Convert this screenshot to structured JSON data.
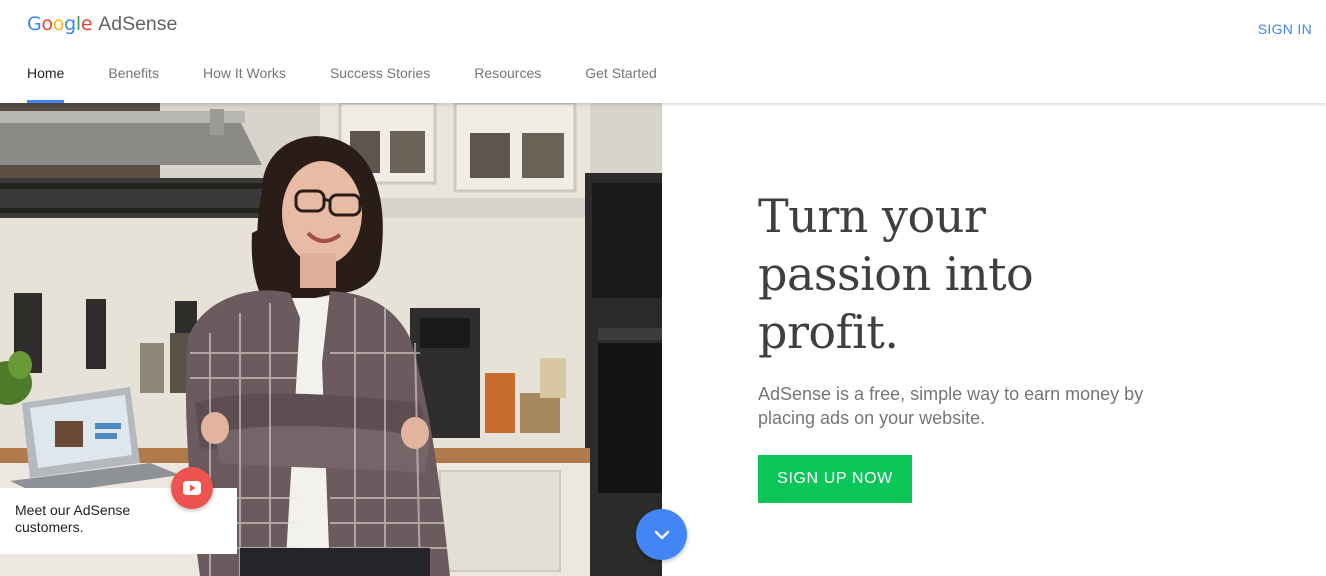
{
  "header": {
    "logo_google": "Google",
    "logo_product": "AdSense",
    "signin_label": "SIGN IN"
  },
  "nav": {
    "items": [
      {
        "label": "Home",
        "active": true
      },
      {
        "label": "Benefits"
      },
      {
        "label": "How It Works"
      },
      {
        "label": "Success Stories"
      },
      {
        "label": "Resources"
      },
      {
        "label": "Get Started"
      }
    ]
  },
  "hero": {
    "headline": "Turn your passion into profit.",
    "subtext": "AdSense is a free, simple way to earn money by placing ads on your website.",
    "cta_label": "SIGN UP NOW",
    "caption": "Meet our AdSense customers."
  },
  "icons": {
    "play": "youtube-play-icon",
    "scroll": "chevron-down-icon"
  },
  "colors": {
    "accent_blue": "#4285f4",
    "cta_green": "#0cc65a",
    "play_red": "#ef5350",
    "google_blue": "#4285f4",
    "google_red": "#ea4335",
    "google_yellow": "#fbbc05",
    "google_green": "#34a853"
  }
}
